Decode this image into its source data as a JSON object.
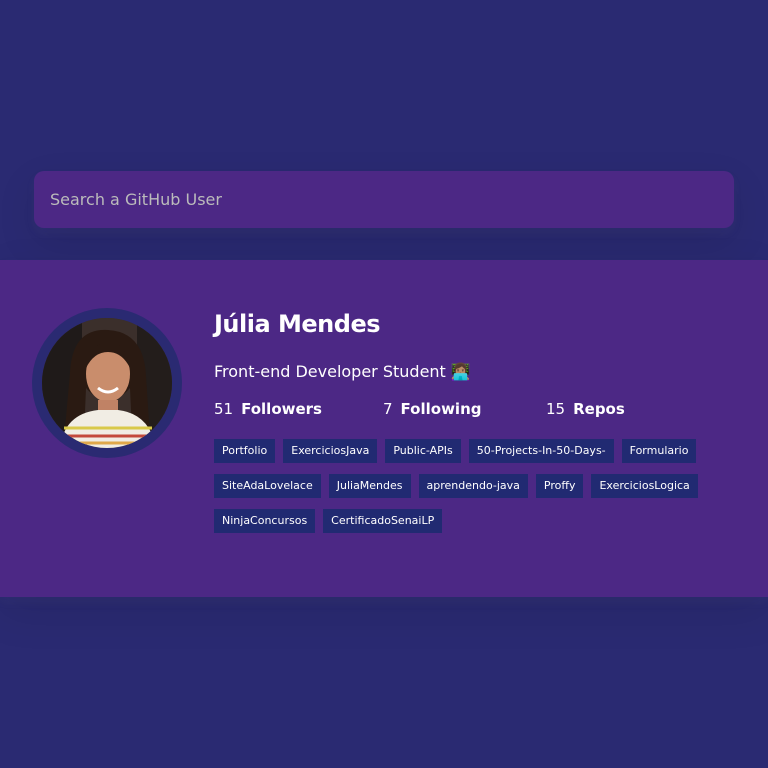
{
  "search": {
    "placeholder": "Search a GitHub User",
    "value": ""
  },
  "profile": {
    "name": "Júlia Mendes",
    "bio": "Front-end Developer Student 👩🏽‍💻",
    "avatar_icon": "user-avatar-photo",
    "stats": [
      {
        "value": "51",
        "label": "Followers"
      },
      {
        "value": "7",
        "label": "Following"
      },
      {
        "value": "15",
        "label": "Repos"
      }
    ],
    "repos": [
      "Portfolio",
      "ExerciciosJava",
      "Public-APIs",
      "50-Projects-In-50-Days-",
      "Formulario",
      "SiteAdaLovelace",
      "JuliaMendes",
      "aprendendo-java",
      "Proffy",
      "ExerciciosLogica",
      "NinjaConcursos",
      "CertificadoSenaiLP"
    ]
  },
  "colors": {
    "background": "#2a2a72",
    "card": "#4c2885",
    "repo_tag": "#212a72",
    "text": "#ffffff"
  }
}
